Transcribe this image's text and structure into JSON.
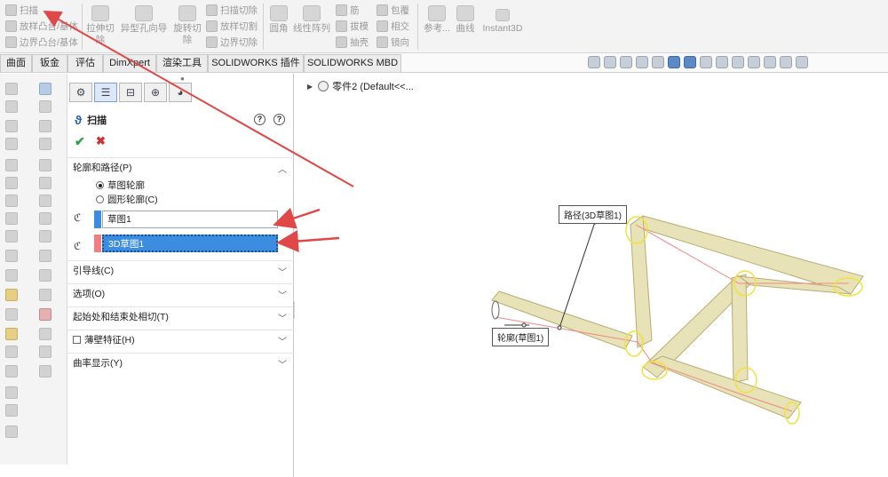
{
  "ribbon": {
    "sweep": "扫描",
    "loft_boss": "放样凸台/基体",
    "boundary_boss": "边界凸台/基体",
    "extruded_cut": "拉伸切\n除",
    "hole_wizard": "异型孔向导",
    "revolved_cut": "旋转切\n除",
    "swept_cut": "扫描切除",
    "lofted_cut": "放样切割",
    "boundary_cut": "边界切除",
    "fillet": "圆角",
    "linear_pattern": "线性阵列",
    "rib": "筋",
    "draft": "拔模",
    "shell": "抽壳",
    "wrap": "包覆",
    "intersect": "相交",
    "mirror": "镜向",
    "reference": "参考...",
    "curves": "曲线",
    "instant3d": "Instant3D"
  },
  "tabs": [
    "曲面",
    "钣金",
    "评估",
    "DimXpert",
    "渲染工具",
    "SOLIDWORKS 插件",
    "SOLIDWORKS MBD"
  ],
  "pm": {
    "title": "扫描",
    "help1": "?",
    "help2": "?",
    "ok": "✔",
    "cancel": "✖",
    "section_profile": "轮廓和路径(P)",
    "radio_sketch": "草图轮廓",
    "radio_circle": "圆形轮廓(C)",
    "profile_value": "草图1",
    "path_value": "3D草图1",
    "guide_curves": "引导线(C)",
    "options": "选项(O)",
    "tangency": "起始处和结束处相切(T)",
    "thin_feature": "薄壁特征(H)",
    "curvature": "曲率显示(Y)"
  },
  "viewport": {
    "tree_label": "零件2  (Default<<...",
    "callout_path": "路径(3D草图1)",
    "callout_profile": "轮廓(草图1)"
  },
  "colors": {
    "accent_blue": "#3c8de0",
    "arrow_red": "#e04848",
    "tube_fill": "#e8e2b8",
    "tube_edge": "#b7ad72"
  }
}
